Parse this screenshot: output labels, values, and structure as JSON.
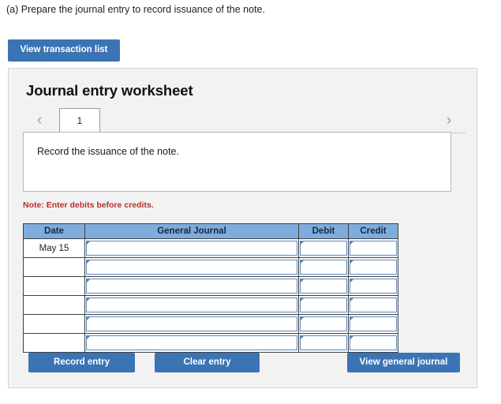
{
  "prompt": "(a) Prepare the journal entry to record issuance of the note.",
  "toolbar": {
    "view_transaction_list_label": "View transaction list"
  },
  "panel": {
    "title": "Journal entry worksheet",
    "tabs": [
      {
        "label": "1",
        "active": true
      }
    ],
    "nav": {
      "prev_icon": "chevron-left-icon",
      "next_icon": "chevron-right-icon",
      "prev_glyph": "‹",
      "next_glyph": "›"
    },
    "instruction": "Record the issuance of the note.",
    "note": "Note: Enter debits before credits."
  },
  "table": {
    "columns": [
      "Date",
      "General Journal",
      "Debit",
      "Credit"
    ],
    "rows": [
      {
        "date": "May 15",
        "general_journal": "",
        "debit": "",
        "credit": ""
      },
      {
        "date": "",
        "general_journal": "",
        "debit": "",
        "credit": ""
      },
      {
        "date": "",
        "general_journal": "",
        "debit": "",
        "credit": ""
      },
      {
        "date": "",
        "general_journal": "",
        "debit": "",
        "credit": ""
      },
      {
        "date": "",
        "general_journal": "",
        "debit": "",
        "credit": ""
      },
      {
        "date": "",
        "general_journal": "",
        "debit": "",
        "credit": ""
      }
    ]
  },
  "footer": {
    "record_entry_label": "Record entry",
    "clear_entry_label": "Clear entry",
    "view_general_journal_label": "View general journal"
  },
  "colors": {
    "button_blue": "#3B74B4",
    "table_header_blue": "#7FACDE",
    "input_border_blue": "#5B87BB",
    "note_red": "#B7312C",
    "panel_background": "#F2F2F2",
    "panel_border": "#D2D2D2"
  }
}
